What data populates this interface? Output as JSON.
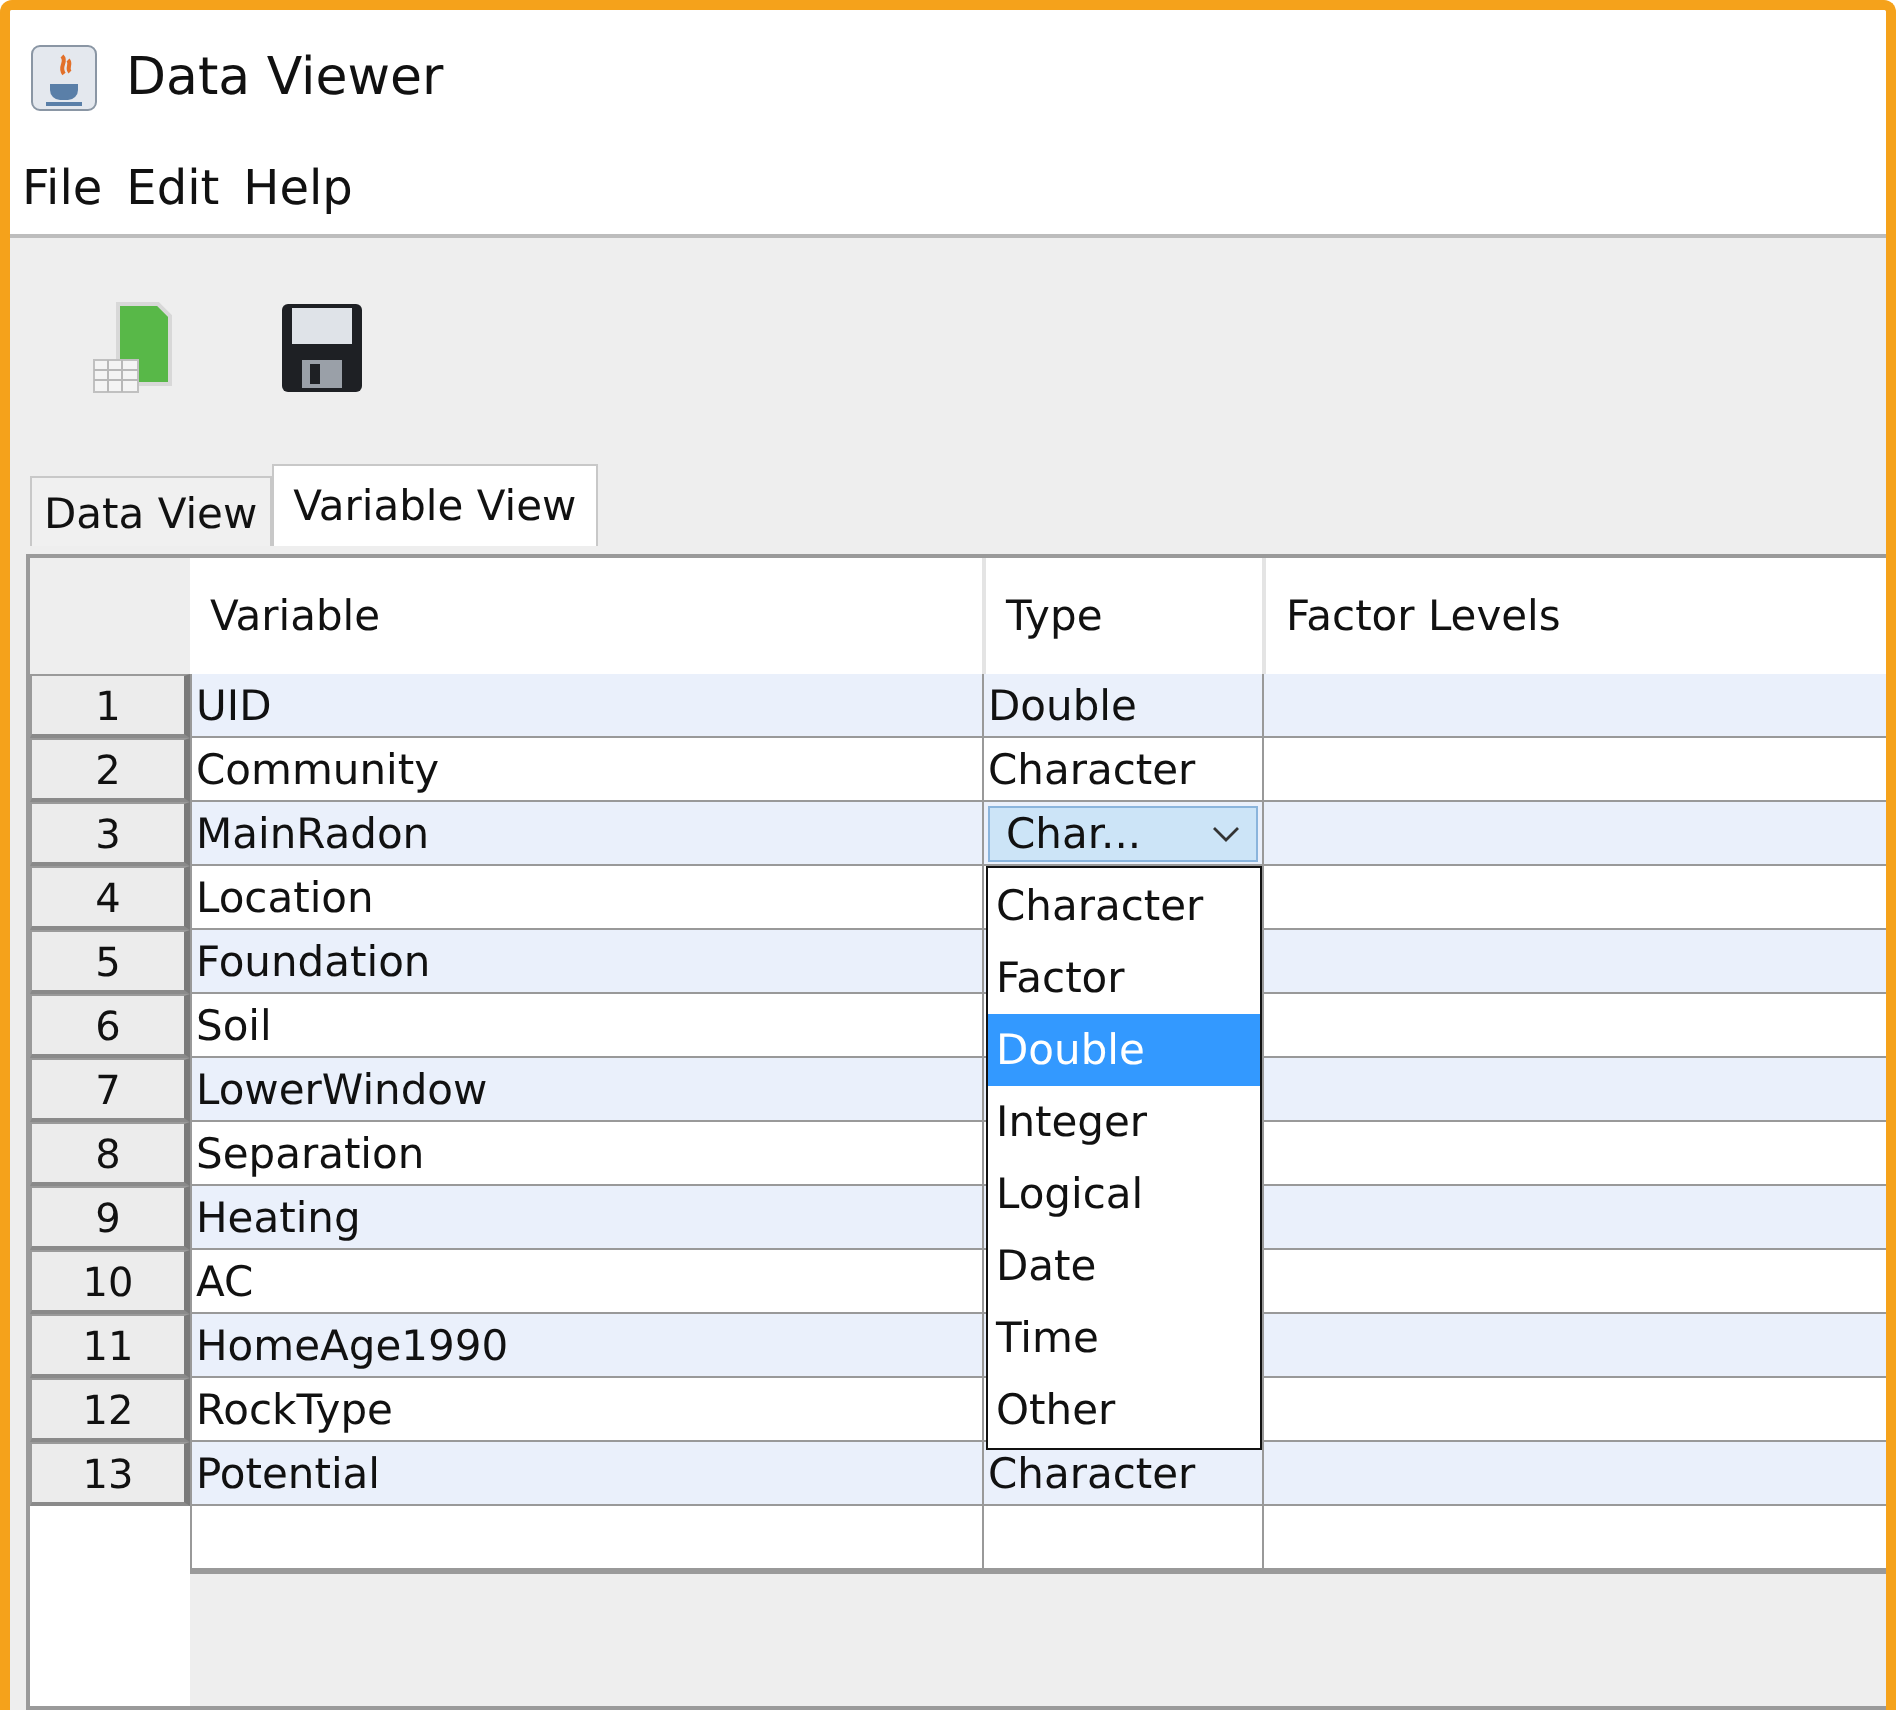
{
  "window": {
    "title": "Data Viewer"
  },
  "menu": [
    "File",
    "Edit",
    "Help"
  ],
  "tabs": [
    {
      "label": "Data View",
      "selected": false
    },
    {
      "label": "Variable View",
      "selected": true
    }
  ],
  "table": {
    "columns": [
      "Variable",
      "Type",
      "Factor Levels"
    ],
    "rows": [
      {
        "number": "1",
        "variable": "UID",
        "type": "Double"
      },
      {
        "number": "2",
        "variable": "Community",
        "type": "Character"
      },
      {
        "number": "3",
        "variable": "MainRadon",
        "type_dropdown": {
          "value": "Char...",
          "expanded": true,
          "options": [
            {
              "label": "Character",
              "selected": false
            },
            {
              "label": "Factor",
              "selected": false
            },
            {
              "label": "Double",
              "selected": true
            },
            {
              "label": "Integer",
              "selected": false
            },
            {
              "label": "Logical",
              "selected": false
            },
            {
              "label": "Date",
              "selected": false
            },
            {
              "label": "Time",
              "selected": false
            },
            {
              "label": "Other",
              "selected": false
            }
          ]
        }
      },
      {
        "number": "4",
        "variable": "Location"
      },
      {
        "number": "5",
        "variable": "Foundation"
      },
      {
        "number": "6",
        "variable": "Soil"
      },
      {
        "number": "7",
        "variable": "LowerWindow"
      },
      {
        "number": "8",
        "variable": "Separation"
      },
      {
        "number": "9",
        "variable": "Heating"
      },
      {
        "number": "10",
        "variable": "AC"
      },
      {
        "number": "11",
        "variable": "HomeAge1990"
      },
      {
        "number": "12",
        "variable": "RockType"
      },
      {
        "number": "13",
        "variable": "Potential",
        "type": "Character"
      }
    ]
  }
}
